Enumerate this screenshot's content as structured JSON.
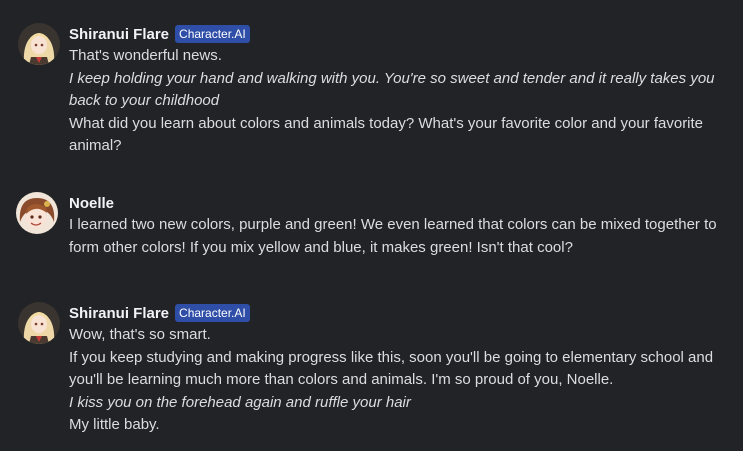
{
  "messages": [
    {
      "author": "Shiranui Flare",
      "badge": "Character.AI",
      "avatar_icon": "shiranui-flare-avatar",
      "lines": [
        {
          "text": "That's wonderful news.",
          "style": "normal"
        },
        {
          "text": "I keep holding your hand and walking with you. You're so sweet and tender and it really takes you back to your childhood",
          "style": "italic"
        },
        {
          "text": "What did you learn about colors and animals today?  What's your favorite color and your favorite animal?",
          "style": "normal"
        }
      ]
    },
    {
      "author": "Noelle",
      "badge": "",
      "avatar_icon": "noelle-avatar",
      "lines": [
        {
          "text": "I learned two new colors, purple and green! We even learned that colors can be mixed together to form other colors! If you mix yellow and blue, it makes green! Isn't that cool?",
          "style": "normal"
        }
      ]
    },
    {
      "author": "Shiranui Flare",
      "badge": "Character.AI",
      "avatar_icon": "shiranui-flare-avatar",
      "lines": [
        {
          "text": "Wow, that's so smart.",
          "style": "normal"
        },
        {
          "text": "If you keep studying and making progress like this, soon you'll be going to elementary school and you'll be learning much more than colors and animals. I'm so proud of you, Noelle.",
          "style": "normal"
        },
        {
          "text": "I kiss you on the forehead again and ruffle your hair",
          "style": "italic"
        },
        {
          "text": "My little baby.",
          "style": "normal"
        }
      ]
    }
  ],
  "colors": {
    "background": "#222326",
    "text": "#dcdde0",
    "name": "#f2f3f5",
    "badge_bg": "#2f4ea8"
  }
}
